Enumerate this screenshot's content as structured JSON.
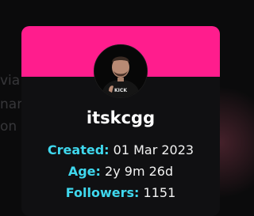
{
  "background": {
    "lines": [
      "via fan",
      "name,",
      "on an and"
    ]
  },
  "profile": {
    "username": "itskcgg",
    "avatar_shirt_text": "KICK",
    "fields": [
      {
        "label": "Created:",
        "value": "01 Mar 2023"
      },
      {
        "label": "Age:",
        "value": "2y 9m 26d"
      },
      {
        "label": "Followers:",
        "value": "1151"
      }
    ]
  },
  "colors": {
    "header": "#ff1d8d",
    "label": "#3fd8ee",
    "card": "#101012",
    "background": "#0b0b0c"
  }
}
